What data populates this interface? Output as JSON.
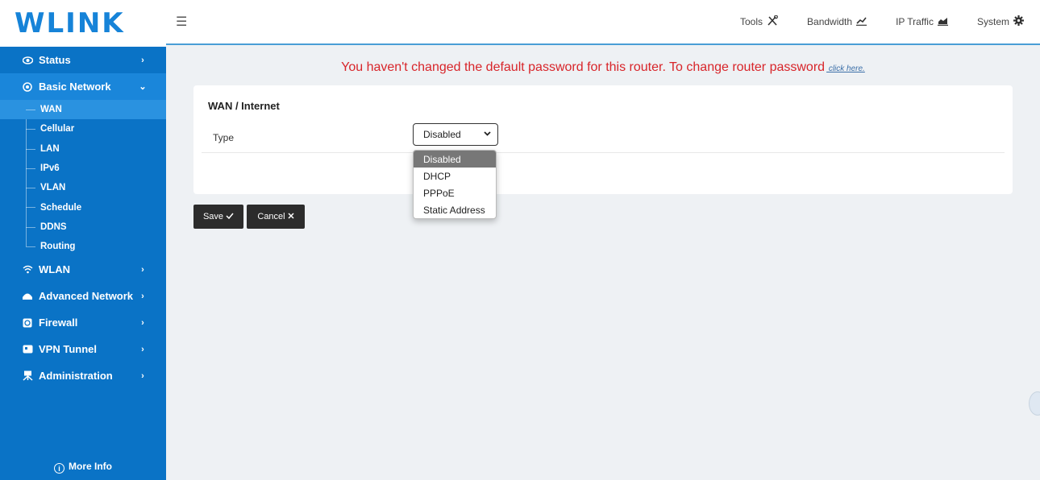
{
  "brand": {
    "logo_text": "WLINK"
  },
  "sidebar": {
    "items": [
      {
        "label": "Status",
        "icon": "eye-icon",
        "chev": "›"
      },
      {
        "label": "Basic Network",
        "icon": "globe-icon",
        "chev": "⌄"
      },
      {
        "label": "WLAN",
        "icon": "wifi-icon",
        "chev": "›"
      },
      {
        "label": "Advanced Network",
        "icon": "router-icon",
        "chev": "›"
      },
      {
        "label": "Firewall",
        "icon": "firewall-icon",
        "chev": "›"
      },
      {
        "label": "VPN Tunnel",
        "icon": "vpn-icon",
        "chev": "›"
      },
      {
        "label": "Administration",
        "icon": "admin-icon",
        "chev": "›"
      }
    ],
    "sub_items": [
      "WAN",
      "Cellular",
      "LAN",
      "IPv6",
      "VLAN",
      "Schedule",
      "DDNS",
      "Routing"
    ],
    "more_info": "More Info"
  },
  "topbar": {
    "menu_icon": "☰",
    "links": [
      {
        "label": "Tools",
        "icon": "tools-icon"
      },
      {
        "label": "Bandwidth",
        "icon": "chart-line-icon"
      },
      {
        "label": "IP Traffic",
        "icon": "chart-area-icon"
      },
      {
        "label": "System",
        "icon": "gear-icon"
      }
    ]
  },
  "warning": {
    "text": "You haven't changed the default password for this router. To change router password",
    "link": " click here."
  },
  "wan": {
    "title": "WAN / Internet",
    "type_label": "Type",
    "type_value": "Disabled",
    "options": [
      "Disabled",
      "DHCP",
      "PPPoE",
      "Static Address"
    ]
  },
  "buttons": {
    "save": "Save",
    "cancel": "Cancel"
  },
  "colors": {
    "sidebar": "#0a73c6",
    "active": "#1a86da",
    "warning": "#d8252a"
  }
}
